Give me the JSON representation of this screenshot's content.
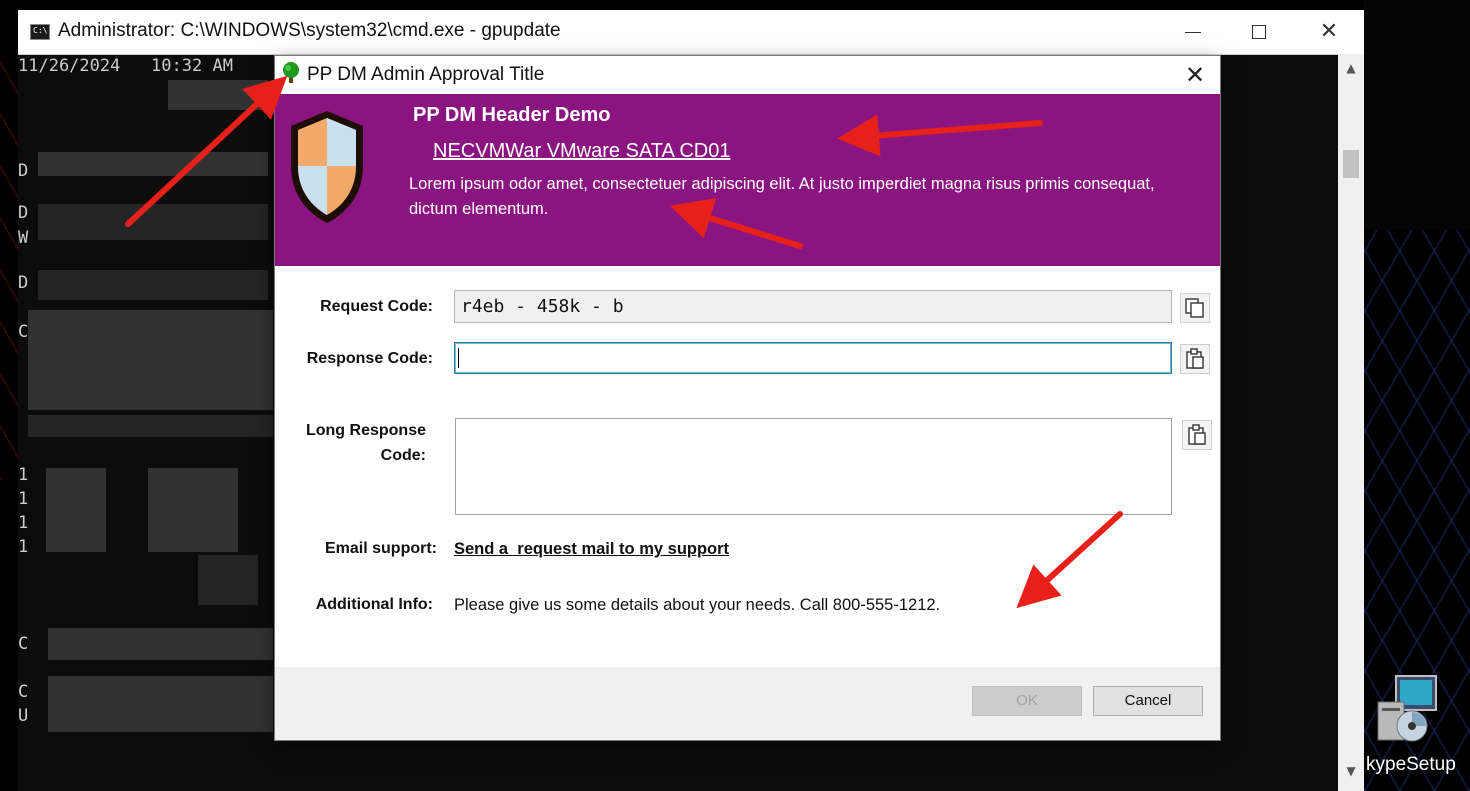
{
  "desktop": {
    "icon_label": "kypeSetup",
    "icon_name": "setup-installer-icon"
  },
  "cmd": {
    "title": "Administrator: C:\\WINDOWS\\system32\\cmd.exe - gpupdate",
    "icon_text": "C:\\",
    "timestamp": "11/26/2024   10:32 AM",
    "line_prefixes": [
      "D",
      "D",
      "W",
      "D",
      "C",
      "1",
      "1",
      "1",
      "1",
      "C",
      "C",
      "U"
    ]
  },
  "dialog": {
    "title": "PP DM Admin Approval Title",
    "title_icon": "tree-icon",
    "close_glyph": "✕",
    "header": {
      "title": "PP DM Header Demo",
      "link": "NECVMWar VMware SATA CD01",
      "description": "Lorem ipsum odor amet, consectetuer adipiscing elit. At justo imperdiet magna risus primis consequat, dictum elementum.",
      "background_color": "#8b1580",
      "shield_icon": "shield-icon"
    },
    "request_code": {
      "label": "Request Code:",
      "value": "r4eb - 458k - b",
      "copy_icon": "copy-icon"
    },
    "response_code": {
      "label": "Response Code:",
      "value": "",
      "paste_icon": "paste-icon"
    },
    "long_response_code": {
      "label_line1": "Long Response",
      "label_line2": "Code:",
      "value": "",
      "paste_icon": "paste-icon"
    },
    "email_support": {
      "label": "Email support:",
      "link": "Send a  request mail to my support"
    },
    "additional_info": {
      "label": "Additional Info:",
      "text": "Please give us some details about your needs. Call 800-555-1212."
    },
    "buttons": {
      "ok": "OK",
      "cancel": "Cancel"
    }
  },
  "annotation_color": "#e8201a"
}
